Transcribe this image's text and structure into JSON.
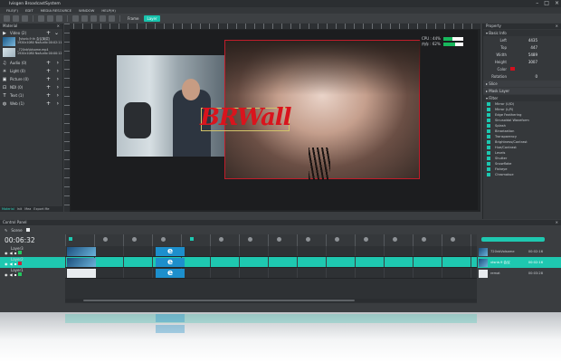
{
  "window": {
    "title": "Ivisgen BroadcastSystem"
  },
  "menu": [
    "FILE(F)",
    "EDIT",
    "MEDIA RESOURCE",
    "WINDOW",
    "HELP(H)"
  ],
  "toolbar": {
    "frame_label": "Frame",
    "layer_label": "Layer"
  },
  "material": {
    "title": "Material",
    "categories": [
      {
        "label": "Video",
        "count": "(2)",
        "icon": "video-icon"
      },
      {
        "label": "Audio",
        "count": "(0)",
        "icon": "audio-icon"
      },
      {
        "label": "Light",
        "count": "(0)",
        "icon": "light-icon"
      },
      {
        "label": "Picture",
        "count": "(0)",
        "icon": "picture-icon"
      },
      {
        "label": "NDI",
        "count": "(0)",
        "icon": "ndi-icon"
      },
      {
        "label": "Text",
        "count": "(1)",
        "icon": "text-icon"
      },
      {
        "label": "Web",
        "count": "(1)",
        "icon": "web-icon"
      }
    ],
    "files": [
      {
        "name": "【vtsnb.9 th 会议演讲】",
        "meta": "1920x1080 NoAudio  00:02:11"
      },
      {
        "name": "_720nbVolsame.mp4",
        "meta": "1920x1080 NoAudio  00:00:12"
      }
    ],
    "tabs": [
      "Material",
      "Init",
      "Mea",
      "Export Me"
    ]
  },
  "canvas": {
    "overlay_text": "BRWall",
    "fps_label": "CPU : 44%",
    "mem_label": "内存 : 62%",
    "cpu_percent": 44,
    "mem_percent": 62
  },
  "property": {
    "title": "Property",
    "basic_info_label": "Basic Info",
    "fields": [
      {
        "key": "Left",
        "value": "4435"
      },
      {
        "key": "Top",
        "value": "447"
      },
      {
        "key": "Width",
        "value": "5489"
      },
      {
        "key": "Height",
        "value": "3007"
      }
    ],
    "color_label": "Color",
    "color_value": "#d2101e",
    "rotation_label": "Rotation",
    "rotation_value": "0",
    "groups": [
      "Slice",
      "Mask Layer",
      "Filter"
    ],
    "filters": [
      "Mirror (U/D)",
      "Mirror (L/R)",
      "Edge Feathering",
      "Sinusoidal Waveform",
      "Splash",
      "Binarization",
      "Transparency",
      "Brightness/Contrast",
      "Hue/Contrast",
      "Levels",
      "Shutter",
      "Snowflake",
      "Fisheye",
      "Chromakue"
    ]
  },
  "control": {
    "title": "Control Panel",
    "scene_label": "Scene",
    "timecode": "00:06:32",
    "layers": [
      "Layer3",
      "Layer2",
      "Layer1"
    ],
    "right_list": [
      {
        "label": "720nbVolsame",
        "time": "00:02:16"
      },
      {
        "label": "vtsnb.9 会议",
        "time": "00:02:16"
      },
      {
        "label": "remat",
        "time": "00:03:28"
      }
    ],
    "slider_percent": 90
  },
  "colors": {
    "accent": "#1ec8b0",
    "overlay_red": "#d9141d",
    "selection": "#c11d2a"
  }
}
